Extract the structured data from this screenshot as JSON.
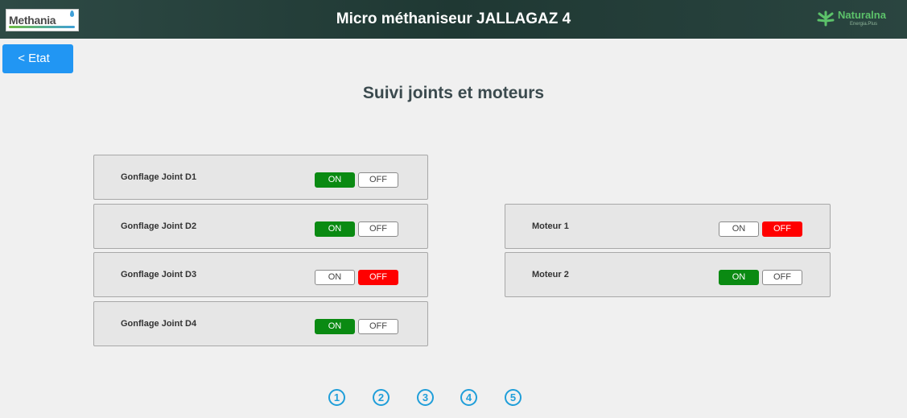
{
  "header": {
    "title": "Micro méthaniseur JALLAGAZ 4",
    "left_logo": "Methania",
    "right_logo": {
      "brand": "Naturalna",
      "tagline": "Energia.Plus"
    }
  },
  "nav": {
    "back_label": "< Etat"
  },
  "page_title": "Suivi joints et moteurs",
  "toggle_labels": {
    "on": "ON",
    "off": "OFF"
  },
  "joints": [
    {
      "label": "Gonflage Joint D1",
      "state": "ON"
    },
    {
      "label": "Gonflage Joint D2",
      "state": "ON"
    },
    {
      "label": "Gonflage Joint D3",
      "state": "OFF"
    },
    {
      "label": "Gonflage Joint D4",
      "state": "ON"
    }
  ],
  "motors": [
    {
      "label": "Moteur 1",
      "state": "OFF"
    },
    {
      "label": "Moteur 2",
      "state": "ON"
    }
  ],
  "pagination": [
    "1",
    "2",
    "3",
    "4",
    "5"
  ],
  "colors": {
    "on_active": "#0a8a12",
    "off_active": "#ff0000",
    "accent": "#2196f3",
    "header": "#1f3833"
  }
}
